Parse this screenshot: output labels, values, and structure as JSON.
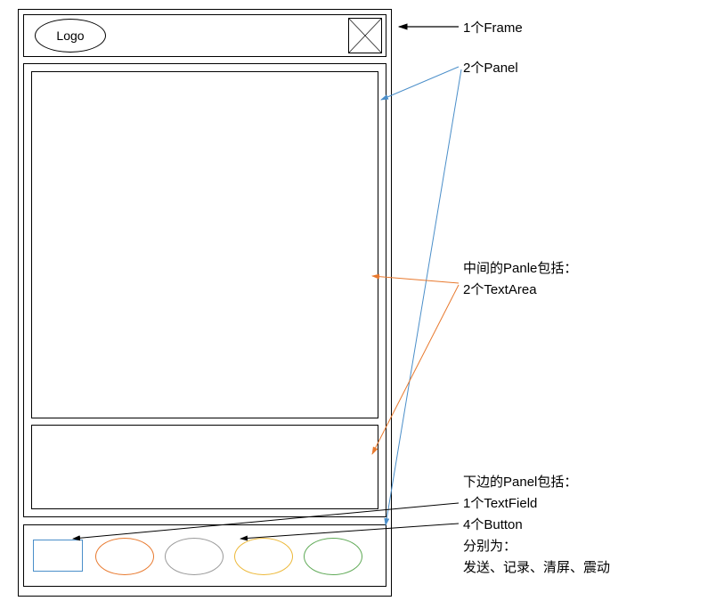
{
  "frame": {
    "logo_label": "Logo"
  },
  "annotations": {
    "frame_label": "1个Frame",
    "panel_label": "2个Panel",
    "mid_panel_title": "中间的Panle包括：",
    "mid_panel_textarea": "2个TextArea",
    "bot_panel_title": "下边的Panel包括：",
    "bot_panel_textfield": "1个TextField",
    "bot_panel_button": "4个Button",
    "bot_panel_button_desc1": "分别为：",
    "bot_panel_button_desc2": "发送、记录、清屏、震动"
  },
  "buttons": [
    "发送",
    "记录",
    "清屏",
    "震动"
  ]
}
